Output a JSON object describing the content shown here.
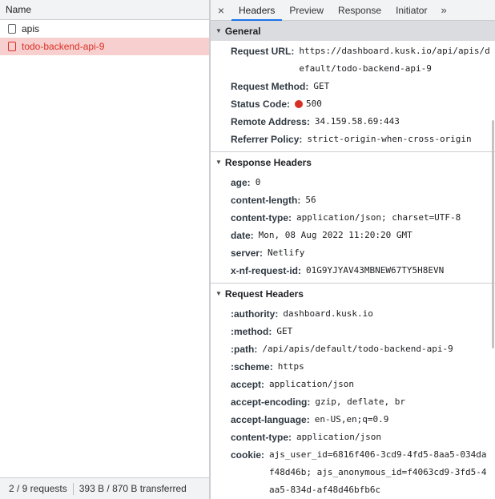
{
  "network_list": {
    "column_header": "Name",
    "rows": [
      {
        "name": "apis",
        "error": false
      },
      {
        "name": "todo-backend-api-9",
        "error": true
      }
    ],
    "footer": {
      "requests": "2 / 9 requests",
      "transferred": "393 B / 870 B transferred"
    }
  },
  "tabs": {
    "close_symbol": "×",
    "items": [
      "Headers",
      "Preview",
      "Response",
      "Initiator"
    ],
    "active": "Headers",
    "more_symbol": "»"
  },
  "sections": {
    "general": {
      "title": "General",
      "rows": [
        {
          "key": "Request URL:",
          "value": "https://dashboard.kusk.io/api/apis/default/todo-backend-api-9"
        },
        {
          "key": "Request Method:",
          "value": "GET"
        },
        {
          "key": "Status Code:",
          "value": "500"
        },
        {
          "key": "Remote Address:",
          "value": "34.159.58.69:443"
        },
        {
          "key": "Referrer Policy:",
          "value": "strict-origin-when-cross-origin"
        }
      ]
    },
    "response_headers": {
      "title": "Response Headers",
      "rows": [
        {
          "key": "age:",
          "value": "0"
        },
        {
          "key": "content-length:",
          "value": "56"
        },
        {
          "key": "content-type:",
          "value": "application/json; charset=UTF-8"
        },
        {
          "key": "date:",
          "value": "Mon, 08 Aug 2022 11:20:20 GMT"
        },
        {
          "key": "server:",
          "value": "Netlify"
        },
        {
          "key": "x-nf-request-id:",
          "value": "01G9YJYAV43MBNEW67TY5H8EVN"
        }
      ]
    },
    "request_headers": {
      "title": "Request Headers",
      "rows": [
        {
          "key": ":authority:",
          "value": "dashboard.kusk.io"
        },
        {
          "key": ":method:",
          "value": "GET"
        },
        {
          "key": ":path:",
          "value": "/api/apis/default/todo-backend-api-9"
        },
        {
          "key": ":scheme:",
          "value": "https"
        },
        {
          "key": "accept:",
          "value": "application/json"
        },
        {
          "key": "accept-encoding:",
          "value": "gzip, deflate, br"
        },
        {
          "key": "accept-language:",
          "value": "en-US,en;q=0.9"
        },
        {
          "key": "content-type:",
          "value": "application/json"
        },
        {
          "key": "cookie:",
          "value": "ajs_user_id=6816f406-3cd9-4fd5-8aa5-034daf48d46b; ajs_anonymous_id=f4063cd9-3fd5-4aa5-834d-af48d46bfb6c"
        }
      ]
    }
  },
  "colors": {
    "error_red": "#d93025",
    "error_row_bg": "#f8cfcf",
    "active_tab_accent": "#1a73e8"
  }
}
